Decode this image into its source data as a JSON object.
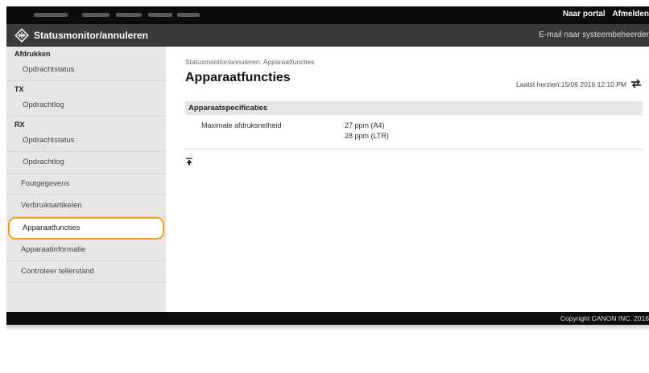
{
  "header": {
    "links": [
      "Naar portal",
      "Afmelden"
    ],
    "title": "Statusmonitor/annuleren",
    "email_link": "E-mail naar systeembeheerder"
  },
  "sidebar": {
    "sections": [
      {
        "label": "Afdrukken",
        "items": [
          "Opdrachtstatus"
        ]
      },
      {
        "label": "TX",
        "items": [
          "Opdrachtlog"
        ]
      },
      {
        "label": "RX",
        "items": [
          "Opdrachtstatus",
          "Opdrachtlog"
        ]
      }
    ],
    "items": [
      "Foutgegevens",
      "Verbruiksartikelen",
      "Apparaatfuncties",
      "Apparaatinformatie",
      "Controleer tellerstand"
    ],
    "selected": "Apparaatfuncties"
  },
  "main": {
    "breadcrumb": "Statusmonitor/annuleren: Apparaatfuncties",
    "title": "Apparaatfuncties",
    "last_updated": "Laatst herzien:15/06 2016 12:10 PM",
    "spec_header": "Apparaatspecificaties",
    "spec_label": "Maximale afdruksnelheid",
    "spec_values": [
      "27 ppm (A4)",
      "28 ppm (LTR)"
    ]
  },
  "footer": {
    "copyright": "Copyright CANON INC. 2016"
  },
  "icons": {
    "logo": "diamond-arrows-icon",
    "refresh": "refresh-icon",
    "top": "go-to-top-icon"
  }
}
